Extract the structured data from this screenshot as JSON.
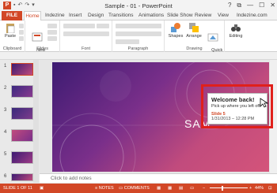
{
  "window": {
    "title": "Sample - 01 - PowerPoint",
    "app_logo": "P",
    "help": "?",
    "controls": [
      "⧉",
      "—",
      "☐",
      "✕"
    ]
  },
  "tabs": [
    "FILE",
    "Home",
    "Indezine",
    "Insert",
    "Design",
    "Transitions",
    "Animations",
    "Slide Show",
    "Review",
    "View",
    "Indezine.com"
  ],
  "ribbon": {
    "paste": "Paste",
    "new_slide": "New\nSlide",
    "shapes": "Shapes",
    "arrange": "Arrange",
    "quick_styles": "Quick\nStyles",
    "editing": "Editing",
    "groups": [
      "Clipboard",
      "Slides",
      "Font",
      "Paragraph",
      "Drawing"
    ]
  },
  "thumbnails": [
    "1",
    "2",
    "3",
    "4",
    "5",
    "6"
  ],
  "slide": {
    "visible_text": "SAM"
  },
  "popup": {
    "title": "Welcome back!",
    "subtitle": "Pick up where you left off:",
    "slide_label": "Slide 5",
    "datetime": "1/31/2013 – 12:28 PM"
  },
  "notes_placeholder": "Click to add notes",
  "status": {
    "slide_of": "SLIDE 1 OF 11",
    "notes": "NOTES",
    "comments": "COMMENTS",
    "zoom": "44%"
  },
  "colors": {
    "accent": "#d24726",
    "highlight": "#e0201b"
  }
}
